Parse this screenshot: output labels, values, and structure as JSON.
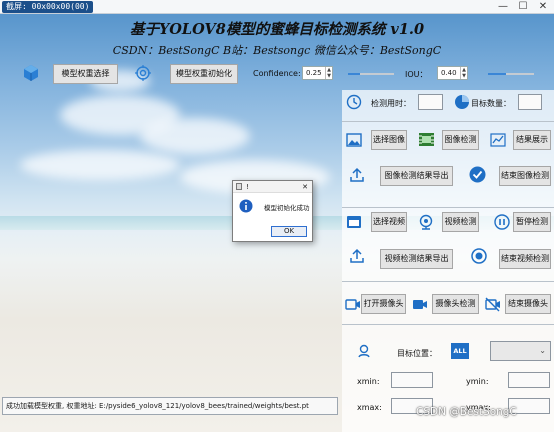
{
  "window": {
    "title_badge": "截屏: 00x00x00(00)",
    "minimize": "—",
    "maximize": "☐",
    "close": "✕"
  },
  "header": {
    "title": "基于YOLOV8模型的蜜蜂目标检测系统 v1.0",
    "subtitle": "CSDN：BestSongC   B站：Bestsongc   微信公众号：BestSongC"
  },
  "model": {
    "select_label": "模型权重选择",
    "init_label": "模型权重初始化"
  },
  "params": {
    "confidence_label": "Confidence:",
    "confidence_value": "0.25",
    "confidence_level": 0.25,
    "iou_label": "IOU：",
    "iou_value": "0.40",
    "iou_level": 0.4
  },
  "stats": {
    "time_label": "检测用时：",
    "time_value": "",
    "count_label": "目标数量：",
    "count_value": ""
  },
  "image": {
    "select_label": "选择图像",
    "detect_label": "图像检测",
    "show_label": "结果展示",
    "export_label": "图像检测结果导出",
    "stop_label": "结束图像检测"
  },
  "video": {
    "select_label": "选择视频",
    "detect_label": "视频检测",
    "pause_label": "暂停检测",
    "export_label": "视频检测结果导出",
    "stop_label": "结束视频检测"
  },
  "camera": {
    "open_label": "打开摄像头",
    "detect_label": "摄像头检测",
    "stop_label": "结束摄像头"
  },
  "target": {
    "position_label": "目标位置：",
    "all_icon_text": "ALL",
    "select_value": "",
    "xmin_label": "xmin:",
    "ymin_label": "ymin:",
    "xmax_label": "xmax:",
    "ymax_label": "ymax:",
    "xmin": "",
    "ymin": "",
    "xmax": "",
    "ymax": ""
  },
  "status": {
    "message": "成功加载模型权重, 权重地址: E:/pyside6_yolov8_121/yolov8_bees/trained/weights/best.pt"
  },
  "dialog": {
    "title": "!",
    "message": "模型初始化成功",
    "ok_label": "OK",
    "close": "✕"
  },
  "watermark": "CSDN @BestSongC",
  "colors": {
    "accent": "#1f6fc5",
    "panel": "#ffffff",
    "button": "#e4e4e4"
  }
}
